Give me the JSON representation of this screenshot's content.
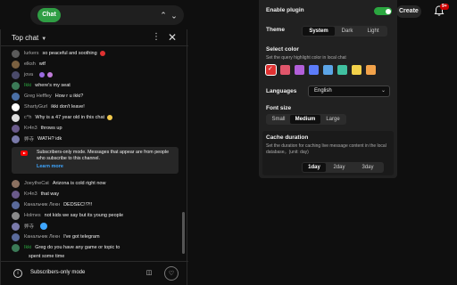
{
  "topbar": {
    "chat_pill": "Chat",
    "create_label": "Create",
    "notif_badge": "9+"
  },
  "chat": {
    "title": "Top chat",
    "messages": [
      {
        "name": "lurkers",
        "text": "so peaceful and soothing",
        "name_color": "#aaaaaa",
        "avatar_color": "#5a5a5a"
      },
      {
        "name": "elksh",
        "text": "wtf",
        "name_color": "#aaaaaa",
        "avatar_color": "#7a6040"
      },
      {
        "name": "jova",
        "text": "",
        "name_color": "#aaaaaa",
        "avatar_color": "#4a4a6a"
      },
      {
        "name": "Ikki",
        "text": "where's my seat",
        "name_color": "#2ba640",
        "avatar_color": "#3b7a57"
      },
      {
        "name": "Greg Heffley",
        "text": "How r u ikki?",
        "name_color": "#aaaaaa",
        "avatar_color": "#4a6fa5"
      },
      {
        "name": "ShartyGurl",
        "text": "ikki don't leave!",
        "name_color": "#aaaaaa",
        "avatar_color": "#ffffff"
      },
      {
        "name": "c^h",
        "text": "Why is a 47 year old in this chat",
        "name_color": "#aaaaaa",
        "avatar_color": "#dddddd"
      },
      {
        "name": "Kr4n3",
        "text": "throws up",
        "name_color": "#aaaaaa",
        "avatar_color": "#6a5a8a"
      },
      {
        "name": "弊寺",
        "text": "WATH? idk",
        "name_color": "#aaaaaa",
        "avatar_color": "#7a7aaa"
      },
      {
        "name": "JoeytheCat",
        "text": "Arizona is cold right now",
        "name_color": "#aaaaaa",
        "avatar_color": "#8a7060"
      },
      {
        "name": "Kr4n3",
        "text": "that way",
        "name_color": "#aaaaaa",
        "avatar_color": "#6a5a8a"
      },
      {
        "name": "Канальчик Лекн",
        "text": "DEDSEC!!?!!",
        "name_color": "#aaaaaa",
        "avatar_color": "#5a6a9a"
      },
      {
        "name": "Holmes",
        "text": "not kids we say but its young people",
        "name_color": "#aaaaaa",
        "avatar_color": "#8a8a8a"
      },
      {
        "name": "弊寺",
        "text": "",
        "name_color": "#aaaaaa",
        "avatar_color": "#7a7aaa"
      },
      {
        "name": "Канальчик Лекн",
        "text": "I've got telegram",
        "name_color": "#aaaaaa",
        "avatar_color": "#5a6a9a"
      },
      {
        "name": "Ikki",
        "text": "Greg do you have any game or topic to",
        "name_color": "#2ba640",
        "avatar_color": "#3b7a57"
      },
      {
        "name": "",
        "text": "spent some time",
        "name_color": "#aaaaaa",
        "avatar_color": ""
      }
    ],
    "subscriber_notice": {
      "text": "Subscribers-only mode. Messages that appear are from people who subscribe to this channel.",
      "link": "Learn more"
    },
    "footer_text": "Subscribers-only mode"
  },
  "settings": {
    "enable_plugin_label": "Enable plugin",
    "enable_plugin_on": true,
    "theme_label": "Theme",
    "theme_options": [
      "System",
      "Dark",
      "Light"
    ],
    "theme_selected": "System",
    "select_color_label": "Select color",
    "select_color_hint": "Set the query highlight color in local chat",
    "swatch_colors": [
      "#e03131",
      "#e0566b",
      "#b25fd9",
      "#5c7cfa",
      "#5ba4e6",
      "#40c0a0",
      "#f2d14a",
      "#f2a24a"
    ],
    "swatch_selected_index": 0,
    "languages_label": "Languages",
    "language_value": "English",
    "font_size_label": "Font size",
    "font_size_options": [
      "Small",
      "Medium",
      "Large"
    ],
    "font_size_selected": "Medium",
    "cache_label": "Cache duration",
    "cache_hint": "Set the duration for caching live message content in the local database。(unit: day)",
    "cache_options": [
      "1day",
      "2day",
      "3day"
    ],
    "cache_selected": "1day"
  }
}
